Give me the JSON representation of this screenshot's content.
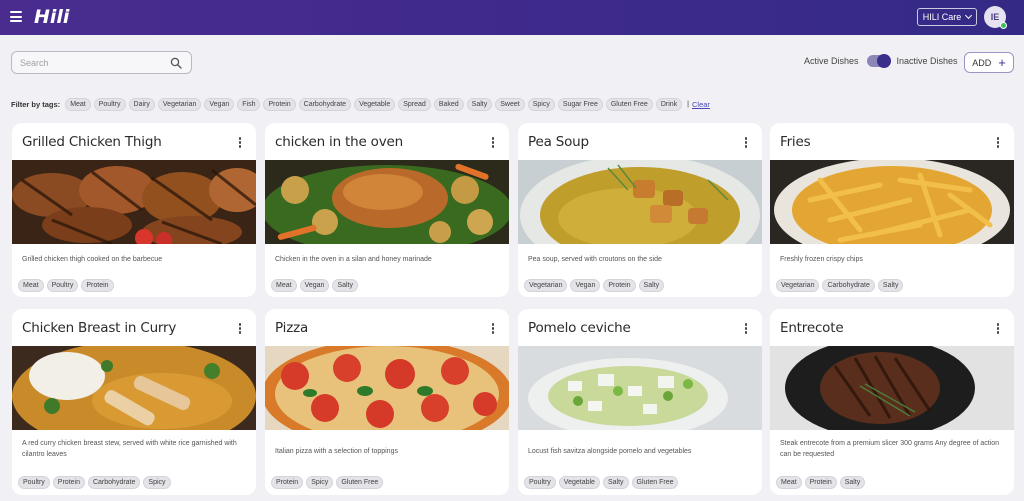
{
  "app": {
    "logo_text": "Hili"
  },
  "header": {
    "org_name": "HILI Care",
    "avatar_initials": "IE"
  },
  "toolbar": {
    "search_placeholder": "Search",
    "active_label": "Active Dishes",
    "inactive_label": "Inactive Dishes",
    "add_label": "ADD"
  },
  "filter": {
    "label": "Filter by tags:",
    "tags": [
      "Meat",
      "Poultry",
      "Dairy",
      "Vegetarian",
      "Vegan",
      "Fish",
      "Protein",
      "Carbohydrate",
      "Vegetable",
      "Spread",
      "Baked",
      "Salty",
      "Sweet",
      "Spicy",
      "Sugar Free",
      "Gluten Free",
      "Drink"
    ],
    "separator": "|",
    "clear_label": "Clear"
  },
  "dishes": [
    {
      "title": "Grilled Chicken Thigh",
      "description": "Grilled chicken thigh cooked on the barbecue",
      "tags": [
        "Meat",
        "Poultry",
        "Protein"
      ]
    },
    {
      "title": "chicken in the oven",
      "description": "Chicken in the oven in a silan and honey marinade",
      "tags": [
        "Meat",
        "Vegan",
        "Salty"
      ]
    },
    {
      "title": "Pea Soup",
      "description": "Pea soup, served with croutons on the side",
      "tags": [
        "Vegetarian",
        "Vegan",
        "Protein",
        "Salty"
      ]
    },
    {
      "title": "Fries",
      "description": "Freshly frozen crispy chips",
      "tags": [
        "Vegetarian",
        "Carbohydrate",
        "Salty"
      ]
    },
    {
      "title": "Chicken Breast in Curry",
      "description": "A red curry chicken breast stew, served with white rice garnished with cilantro leaves",
      "tags": [
        "Poultry",
        "Protein",
        "Carbohydrate",
        "Spicy"
      ]
    },
    {
      "title": "Pizza",
      "description": "Italian pizza with a selection of toppings",
      "tags": [
        "Protein",
        "Spicy",
        "Gluten Free"
      ]
    },
    {
      "title": "Pomelo ceviche",
      "description": "Locust fish savitza alongside pomelo and vegetables",
      "tags": [
        "Poultry",
        "Vegetable",
        "Salty",
        "Gluten Free"
      ]
    },
    {
      "title": "Entrecote",
      "description": "Steak entrecote from a premium slicer 300 grams Any degree of action can be requested",
      "tags": [
        "Meat",
        "Protein",
        "Salty"
      ]
    }
  ],
  "icons": {
    "menu": "hamburger-icon",
    "search": "search-icon",
    "dropdown": "chevron-down-icon",
    "add": "plus-icon",
    "card_menu": "more-vertical-icon"
  },
  "colors": {
    "header_start": "#4a2c8f",
    "header_end": "#342a86",
    "toggle_knob": "#3a2f8a",
    "link": "#4a47b8",
    "status_online": "#3bbf5a"
  }
}
